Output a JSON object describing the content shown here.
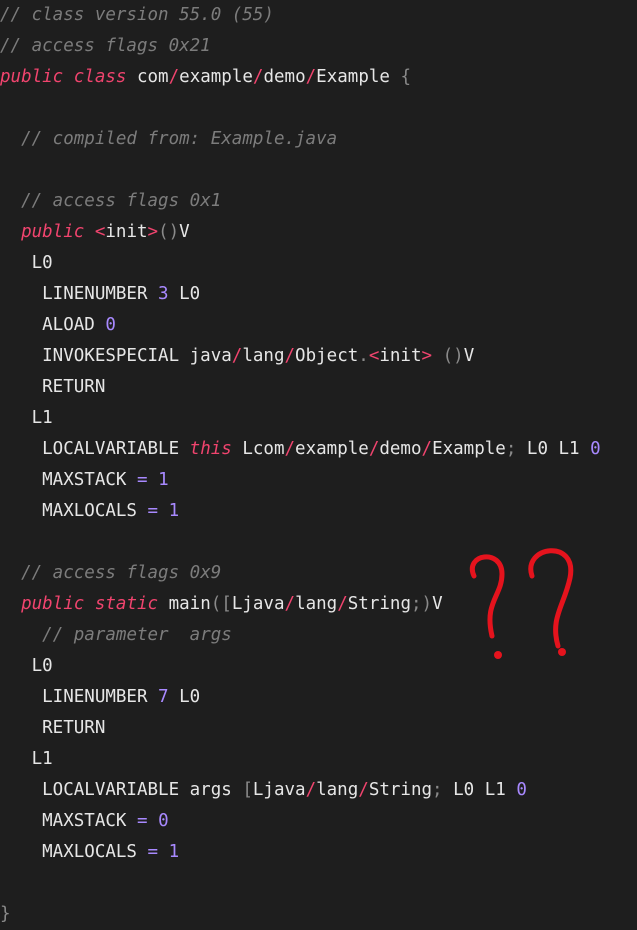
{
  "theme": {
    "background": "#1e1e1e",
    "comment": "#7c7c7c",
    "keyword": "#f0446e",
    "number": "#a889ff",
    "plain": "#e6e6e6",
    "annotation": "#e5131d"
  },
  "lines": [
    {
      "tokens": [
        [
          "comment",
          "// class version 55.0 (55)"
        ]
      ]
    },
    {
      "tokens": [
        [
          "comment",
          "// access flags 0x21"
        ]
      ]
    },
    {
      "tokens": [
        [
          "keyword",
          "public"
        ],
        [
          "plain",
          " "
        ],
        [
          "keyword",
          "class"
        ],
        [
          "plain",
          " com"
        ],
        [
          "slash",
          "/"
        ],
        [
          "plain",
          "example"
        ],
        [
          "slash",
          "/"
        ],
        [
          "plain",
          "demo"
        ],
        [
          "slash",
          "/"
        ],
        [
          "plain",
          "Example "
        ],
        [
          "punct",
          "{"
        ]
      ]
    },
    {
      "tokens": []
    },
    {
      "tokens": [
        [
          "plain",
          "  "
        ],
        [
          "comment",
          "// compiled from: Example.java"
        ]
      ]
    },
    {
      "tokens": []
    },
    {
      "tokens": [
        [
          "plain",
          "  "
        ],
        [
          "comment",
          "// access flags 0x1"
        ]
      ]
    },
    {
      "tokens": [
        [
          "plain",
          "  "
        ],
        [
          "keyword",
          "public"
        ],
        [
          "plain",
          " "
        ],
        [
          "slash",
          "<"
        ],
        [
          "plain",
          "init"
        ],
        [
          "slash",
          ">"
        ],
        [
          "punct",
          "()"
        ],
        [
          "plain",
          "V"
        ]
      ]
    },
    {
      "tokens": [
        [
          "plain",
          "   L0"
        ]
      ]
    },
    {
      "tokens": [
        [
          "plain",
          "    LINENUMBER "
        ],
        [
          "number",
          "3"
        ],
        [
          "plain",
          " L0"
        ]
      ]
    },
    {
      "tokens": [
        [
          "plain",
          "    ALOAD "
        ],
        [
          "number",
          "0"
        ]
      ]
    },
    {
      "tokens": [
        [
          "plain",
          "    INVOKESPECIAL java"
        ],
        [
          "slash",
          "/"
        ],
        [
          "plain",
          "lang"
        ],
        [
          "slash",
          "/"
        ],
        [
          "plain",
          "Object"
        ],
        [
          "punct",
          "."
        ],
        [
          "slash",
          "<"
        ],
        [
          "plain",
          "init"
        ],
        [
          "slash",
          ">"
        ],
        [
          "plain",
          " "
        ],
        [
          "punct",
          "()"
        ],
        [
          "plain",
          "V"
        ]
      ]
    },
    {
      "tokens": [
        [
          "plain",
          "    RETURN"
        ]
      ]
    },
    {
      "tokens": [
        [
          "plain",
          "   L1"
        ]
      ]
    },
    {
      "tokens": [
        [
          "plain",
          "    LOCALVARIABLE "
        ],
        [
          "keyword",
          "this"
        ],
        [
          "plain",
          " Lcom"
        ],
        [
          "slash",
          "/"
        ],
        [
          "plain",
          "example"
        ],
        [
          "slash",
          "/"
        ],
        [
          "plain",
          "demo"
        ],
        [
          "slash",
          "/"
        ],
        [
          "plain",
          "Example"
        ],
        [
          "punct",
          ";"
        ],
        [
          "plain",
          " L0 L1 "
        ],
        [
          "number",
          "0"
        ]
      ]
    },
    {
      "tokens": [
        [
          "plain",
          "    MAXSTACK "
        ],
        [
          "op",
          "="
        ],
        [
          "plain",
          " "
        ],
        [
          "number",
          "1"
        ]
      ]
    },
    {
      "tokens": [
        [
          "plain",
          "    MAXLOCALS "
        ],
        [
          "op",
          "="
        ],
        [
          "plain",
          " "
        ],
        [
          "number",
          "1"
        ]
      ]
    },
    {
      "tokens": []
    },
    {
      "tokens": [
        [
          "plain",
          "  "
        ],
        [
          "comment",
          "// access flags 0x9"
        ]
      ]
    },
    {
      "tokens": [
        [
          "plain",
          "  "
        ],
        [
          "keyword",
          "public"
        ],
        [
          "plain",
          " "
        ],
        [
          "keyword",
          "static"
        ],
        [
          "plain",
          " main"
        ],
        [
          "punct",
          "(["
        ],
        [
          "plain",
          "Ljava"
        ],
        [
          "slash",
          "/"
        ],
        [
          "plain",
          "lang"
        ],
        [
          "slash",
          "/"
        ],
        [
          "plain",
          "String"
        ],
        [
          "punct",
          ";)"
        ],
        [
          "plain",
          "V"
        ]
      ]
    },
    {
      "tokens": [
        [
          "plain",
          "    "
        ],
        [
          "comment",
          "// parameter  args"
        ]
      ]
    },
    {
      "tokens": [
        [
          "plain",
          "   L0"
        ]
      ]
    },
    {
      "tokens": [
        [
          "plain",
          "    LINENUMBER "
        ],
        [
          "number",
          "7"
        ],
        [
          "plain",
          " L0"
        ]
      ]
    },
    {
      "tokens": [
        [
          "plain",
          "    RETURN"
        ]
      ]
    },
    {
      "tokens": [
        [
          "plain",
          "   L1"
        ]
      ]
    },
    {
      "tokens": [
        [
          "plain",
          "    LOCALVARIABLE args "
        ],
        [
          "punct",
          "["
        ],
        [
          "plain",
          "Ljava"
        ],
        [
          "slash",
          "/"
        ],
        [
          "plain",
          "lang"
        ],
        [
          "slash",
          "/"
        ],
        [
          "plain",
          "String"
        ],
        [
          "punct",
          ";"
        ],
        [
          "plain",
          " L0 L1 "
        ],
        [
          "number",
          "0"
        ]
      ]
    },
    {
      "tokens": [
        [
          "plain",
          "    MAXSTACK "
        ],
        [
          "op",
          "="
        ],
        [
          "plain",
          " "
        ],
        [
          "number",
          "0"
        ]
      ]
    },
    {
      "tokens": [
        [
          "plain",
          "    MAXLOCALS "
        ],
        [
          "op",
          "="
        ],
        [
          "plain",
          " "
        ],
        [
          "number",
          "1"
        ]
      ]
    },
    {
      "tokens": []
    },
    {
      "tokens": [
        [
          "punct",
          "}"
        ]
      ]
    }
  ],
  "annotation": {
    "text": "??",
    "color": "#e5131d"
  }
}
